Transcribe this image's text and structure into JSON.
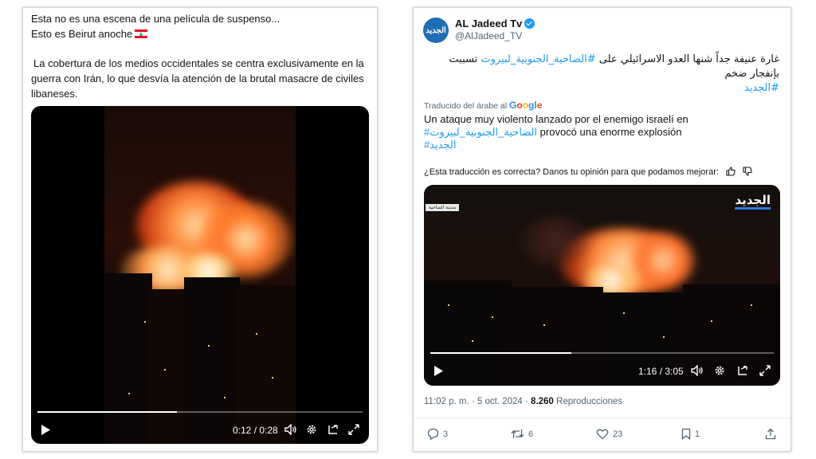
{
  "left_tweet": {
    "line1": "Esta no es una escena de una película de suspenso...",
    "line2": "Esto es Beirut anoche",
    "flag_icon": "lebanon-flag",
    "body": "La cobertura de los medios occidentales se centra exclusivamente en la guerra con Irán, lo que desvía la atención de la brutal masacre de civiles libaneses.",
    "video": {
      "time": "0:12 / 0:28",
      "progress": 0.43
    }
  },
  "right_tweet": {
    "name": "AL Jadeed Tv",
    "handle": "@AlJadeed_TV",
    "avatar_text": "الجديد",
    "arabic_line1_pre": "غارة عنيفة جداً شنها العدو الاسرائيلي على ",
    "arabic_line1_link": "#الضاحية_الجنوبية_لبيروت",
    "arabic_line1_post": " تسببت",
    "arabic_line2": "بإنفجار ضخم",
    "arabic_hashtag": "#الجديد",
    "translated_label": "Traducido del árabe al",
    "google": "Google",
    "translation_line1": "Un ataque muy violento lanzado por el enemigo israelí en",
    "translation_link": "#الضاحية_الجنوبية_لبيروت",
    "translation_line2_post": " provocó una enorme explosión",
    "translation_hashtag": "#الجديد",
    "feedback": "¿Esta traducción es correcta? Danos tu opinión para que podamos mejorar:",
    "video": {
      "time": "1:16 / 3:05",
      "progress": 0.41,
      "channel_logo": "الجديد",
      "location_label": "مدينة الضاحية"
    },
    "timestamp": "11:02 p. m. · 5 oct. 2024 ·",
    "views": "8.260",
    "views_label": "Reproducciones",
    "actions": {
      "replies": "3",
      "reposts": "6",
      "likes": "23",
      "bookmarks": "1"
    }
  }
}
